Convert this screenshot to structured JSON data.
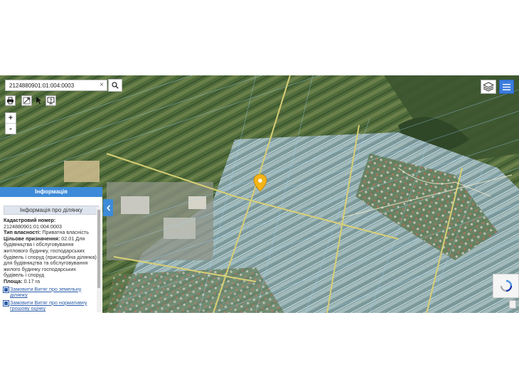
{
  "search": {
    "value": "2124880901:01:004:0003",
    "clear_label": "×"
  },
  "zoom": {
    "in_label": "+",
    "out_label": "-"
  },
  "panel": {
    "header": "Інформація",
    "title": "Інформація про ділянку",
    "cadastral_label": "Кадастровий номер:",
    "cadastral_value": "2124880901:01:004:0003",
    "ownership_label": "Тип власності:",
    "ownership_value": "Приватна власність",
    "purpose_label": "Цільове призначення:",
    "purpose_value": "02.01 Для будівництва і обслуговування житлового будинку, господарських будівель і споруд (присадибна ділянка) для будівництва та обслуговування жилого будинку господарських будівель і споруд",
    "area_label": "Площа:",
    "area_value": "0.17 га",
    "link1": "Замовити Витяг про земельну ділянку",
    "link2": "Замовити Витяг про нормативну грошову оцінку"
  },
  "icons": {
    "search": "search-icon",
    "print": "print-icon",
    "measure": "measure-icon",
    "select": "pointer-icon",
    "info": "info-icon",
    "layers": "layers-icon",
    "menu": "hamburger-icon",
    "collapse": "chevron-left-icon",
    "marker": "map-marker-icon"
  },
  "colors": {
    "accent": "#3d8bd8",
    "menu": "#3b7ddd",
    "marker": "#f2b417",
    "parcel_line": "#9fd7ff",
    "road": "#d8cf76"
  }
}
